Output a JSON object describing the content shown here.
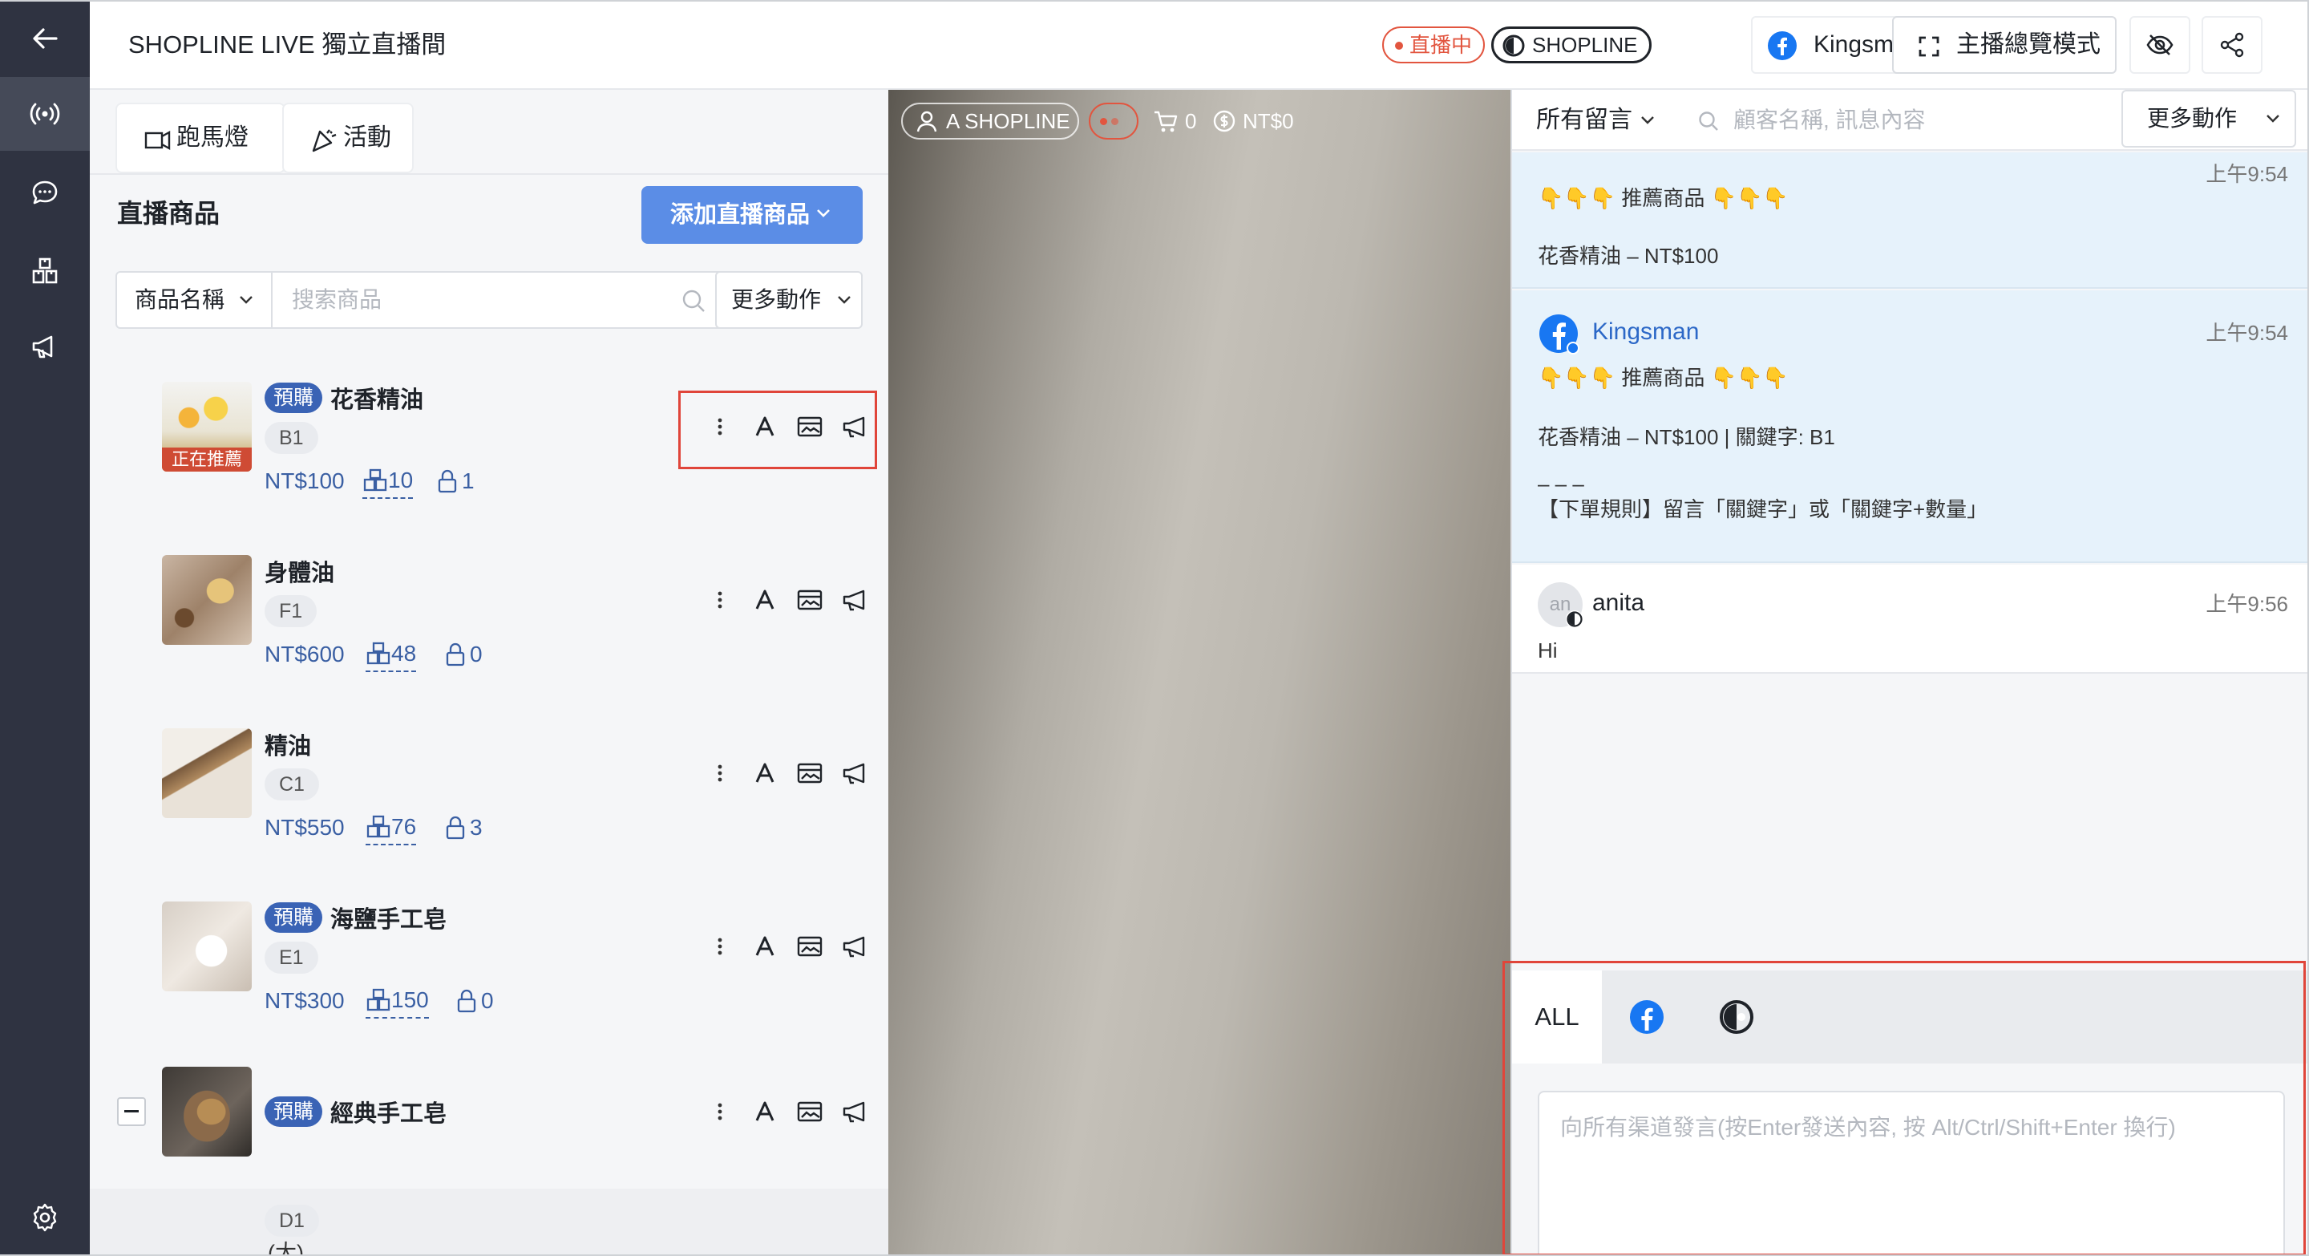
{
  "app": {
    "title": "SHOPLINE LIVE 獨立直播間"
  },
  "header": {
    "live_status": "直播中",
    "brand": "SHOPLINE",
    "account_name": "Kingsman",
    "overview_label": "主播總覽模式"
  },
  "toolbar": {
    "marquee_label": "跑馬燈",
    "activity_label": "活動"
  },
  "products_section": {
    "title": "直播商品",
    "add_button": "添加直播商品",
    "search_field_label": "商品名稱",
    "search_placeholder": "搜索商品",
    "more_actions": "更多動作"
  },
  "products": [
    {
      "name": "花香精油",
      "preorder": "預購",
      "keyword": "B1",
      "price": "NT$100",
      "stock": "10",
      "locked": "1",
      "recommending": "正在推薦"
    },
    {
      "name": "身體油",
      "keyword": "F1",
      "price": "NT$600",
      "stock": "48",
      "locked": "0"
    },
    {
      "name": "精油",
      "keyword": "C1",
      "price": "NT$550",
      "stock": "76",
      "locked": "3"
    },
    {
      "name": "海鹽手工皂",
      "preorder": "預購",
      "keyword": "E1",
      "price": "NT$300",
      "stock": "150",
      "locked": "0"
    },
    {
      "name": "經典手工皂",
      "preorder": "預購",
      "variant_keyword": "D1",
      "variant_name": "(大)"
    }
  ],
  "video_overlay": {
    "host": "A SHOPLINE",
    "cart_count": "0",
    "revenue": "NT$0"
  },
  "comments_panel": {
    "filter": "所有留言",
    "search_placeholder": "顧客名稱, 訊息內容",
    "more_actions": "更多動作"
  },
  "messages": [
    {
      "time": "上午9:54",
      "lines": [
        "👇👇👇 推薦商品 👇👇👇",
        "花香精油 – NT$100"
      ]
    },
    {
      "author": "Kingsman",
      "time": "上午9:54",
      "lines": [
        "👇👇👇 推薦商品 👇👇👇",
        "花香精油 – NT$100 | 關鍵字: B1",
        "– – –",
        "【下單規則】留言「關鍵字」或「關鍵字+數量」"
      ]
    },
    {
      "author": "anita",
      "avatar_initials": "an",
      "time": "上午9:56",
      "lines": [
        "Hi"
      ]
    }
  ],
  "channels": {
    "all_label": "ALL",
    "icons": [
      "facebook-icon",
      "shopline-icon"
    ]
  },
  "composer": {
    "placeholder": "向所有渠道發言(按Enter發送內容, 按 Alt/Ctrl/Shift+Enter 換行)"
  },
  "colors": {
    "sidebar": "#2f3341",
    "accent": "#5b8de6",
    "live": "#e2553f",
    "highlight": "#e6f2fb",
    "price": "#3a5fa3",
    "preorder": "#3a63b5",
    "annotation": "#e0453a"
  }
}
